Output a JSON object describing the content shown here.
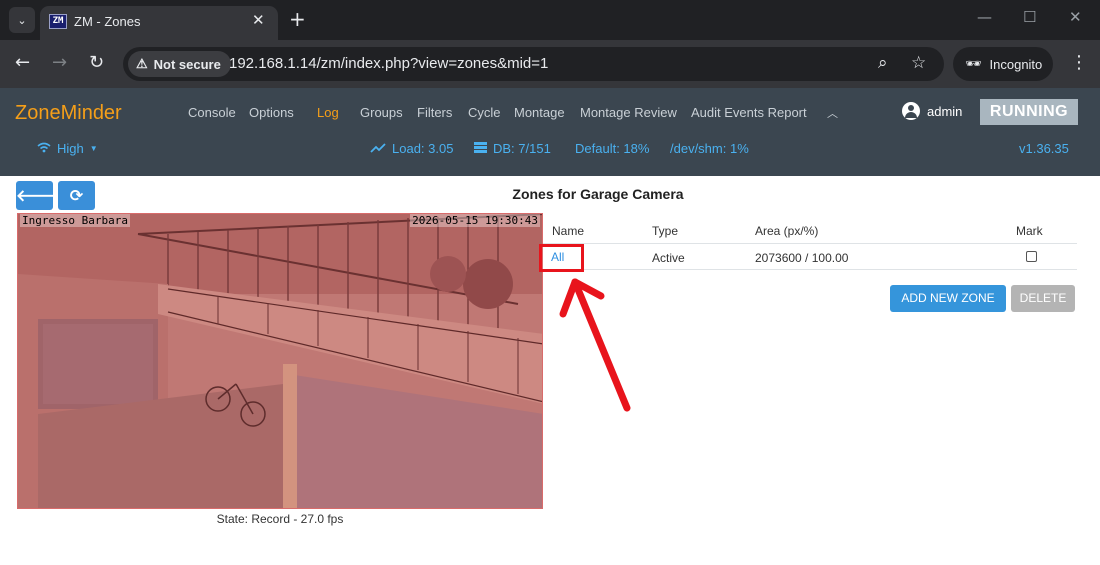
{
  "browser": {
    "tab_title": "ZM - Zones",
    "favicon_text": "ZM",
    "security_label": "Not secure",
    "url": "192.168.1.14/zm/index.php?view=zones&mid=1",
    "incognito_label": "Incognito"
  },
  "zm": {
    "brand": "ZoneMinder",
    "menu": [
      "Console",
      "Options",
      "Log",
      "Groups",
      "Filters",
      "Cycle",
      "Montage",
      "Montage Review",
      "Audit Events Report"
    ],
    "active_menu": "Log",
    "user": "admin",
    "status": "RUNNING",
    "bandwidth": "High",
    "load": "Load: 3.05",
    "db": "DB: 7/151",
    "default_storage": "Default: 18%",
    "shm": "/dev/shm: 1%",
    "version": "v1.36.35",
    "colors": {
      "nav_bg": "#3b4650",
      "brand": "#f59f19",
      "link": "#4ab1f0",
      "status_bg": "#a9b6bf"
    }
  },
  "page": {
    "title": "Zones for Garage Camera",
    "camera": {
      "overlay_left": "Ingresso Barbara",
      "overlay_right": "2026-05-15 19:30:43",
      "state": "State: Record - 27.0 fps"
    },
    "table": {
      "headers": {
        "name": "Name",
        "type": "Type",
        "area": "Area (px/%)",
        "mark": "Mark"
      },
      "rows": [
        {
          "name": "All",
          "type": "Active",
          "area": "2073600 / 100.00",
          "mark": false
        }
      ]
    },
    "buttons": {
      "add": "ADD NEW ZONE",
      "delete": "DELETE"
    }
  }
}
